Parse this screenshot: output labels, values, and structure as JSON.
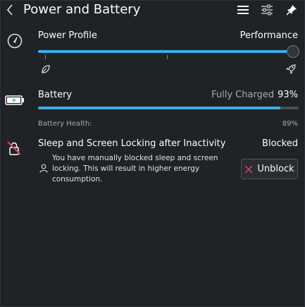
{
  "header": {
    "title": "Power and Battery"
  },
  "power_profile": {
    "label": "Power Profile",
    "value_label": "Performance",
    "level_fraction": 1.0
  },
  "battery": {
    "label": "Battery",
    "status": "Fully Charged",
    "percent_text": "93%",
    "charge_fraction": 0.93,
    "health_label": "Battery Health:",
    "health_value": "89%"
  },
  "inhibition": {
    "title": "Sleep and Screen Locking after Inactivity",
    "state": "Blocked",
    "description_lines": [
      "You have manually blocked sleep and screen",
      "locking. This will result in higher energy",
      "consumption."
    ],
    "button_label": "Unblock"
  },
  "colors": {
    "accent": "#3daee9",
    "background": "#202326",
    "danger": "#da4453"
  }
}
